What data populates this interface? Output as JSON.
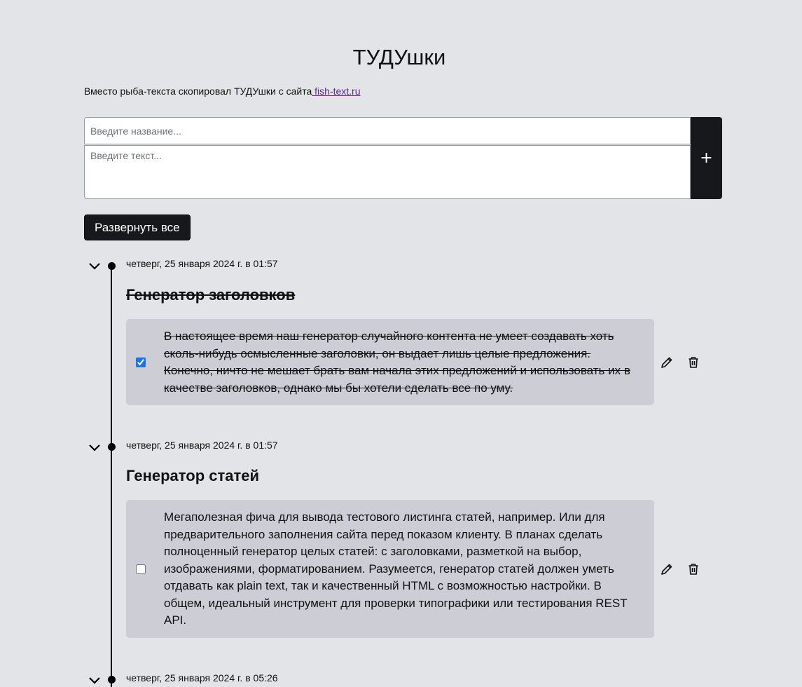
{
  "header": {
    "title": "ТУДУшки",
    "intro_text": "Вместо рыба-текста скопировал ТУДУшки с сайта",
    "intro_link": " fish-text.ru"
  },
  "form": {
    "title_placeholder": "Введите название...",
    "text_placeholder": "Введите текст...",
    "add_label": "+"
  },
  "controls": {
    "expand_all_label": "Развернуть все"
  },
  "todos": [
    {
      "date": "четверг, 25 января 2024 г. в 01:57",
      "title": "Генератор заголовков",
      "text": "В настоящее время наш генератор случайного контента не умеет создавать хоть сколь-нибудь осмысленные заголовки, он выдает лишь целые предложения. Конечно, ничто не мешает брать вам начала этих предложений и использовать их в качестве заголовков, однако мы бы хотели сделать все по уму.",
      "completed": true
    },
    {
      "date": "четверг, 25 января 2024 г. в 01:57",
      "title": "Генератор статей",
      "text": "Мегаполезная фича для вывода тестового листинга статей, например. Или для предварительного заполнения сайта перед показом клиенту. В планах сделать полноценный генератор целых статей: с заголовками, разметкой на выбор, изображениями, форматированием. Разумеется, генератор статей должен уметь отдавать как plain text, так и качественный HTML с возможностью настройки. В общем, идеальный инструмент для проверки типографики или тестирования REST API.",
      "completed": false
    },
    {
      "date": "четверг, 25 января 2024 г. в 05:26"
    }
  ],
  "icons": {
    "chevron": "chevron-down-icon",
    "edit": "pencil-icon",
    "delete": "trash-icon"
  },
  "colors": {
    "background": "#e3e4e8",
    "card": "#cccdd5",
    "button": "#17181c",
    "link": "#5b2a86",
    "checkbox_checked": "#1a73e8"
  }
}
